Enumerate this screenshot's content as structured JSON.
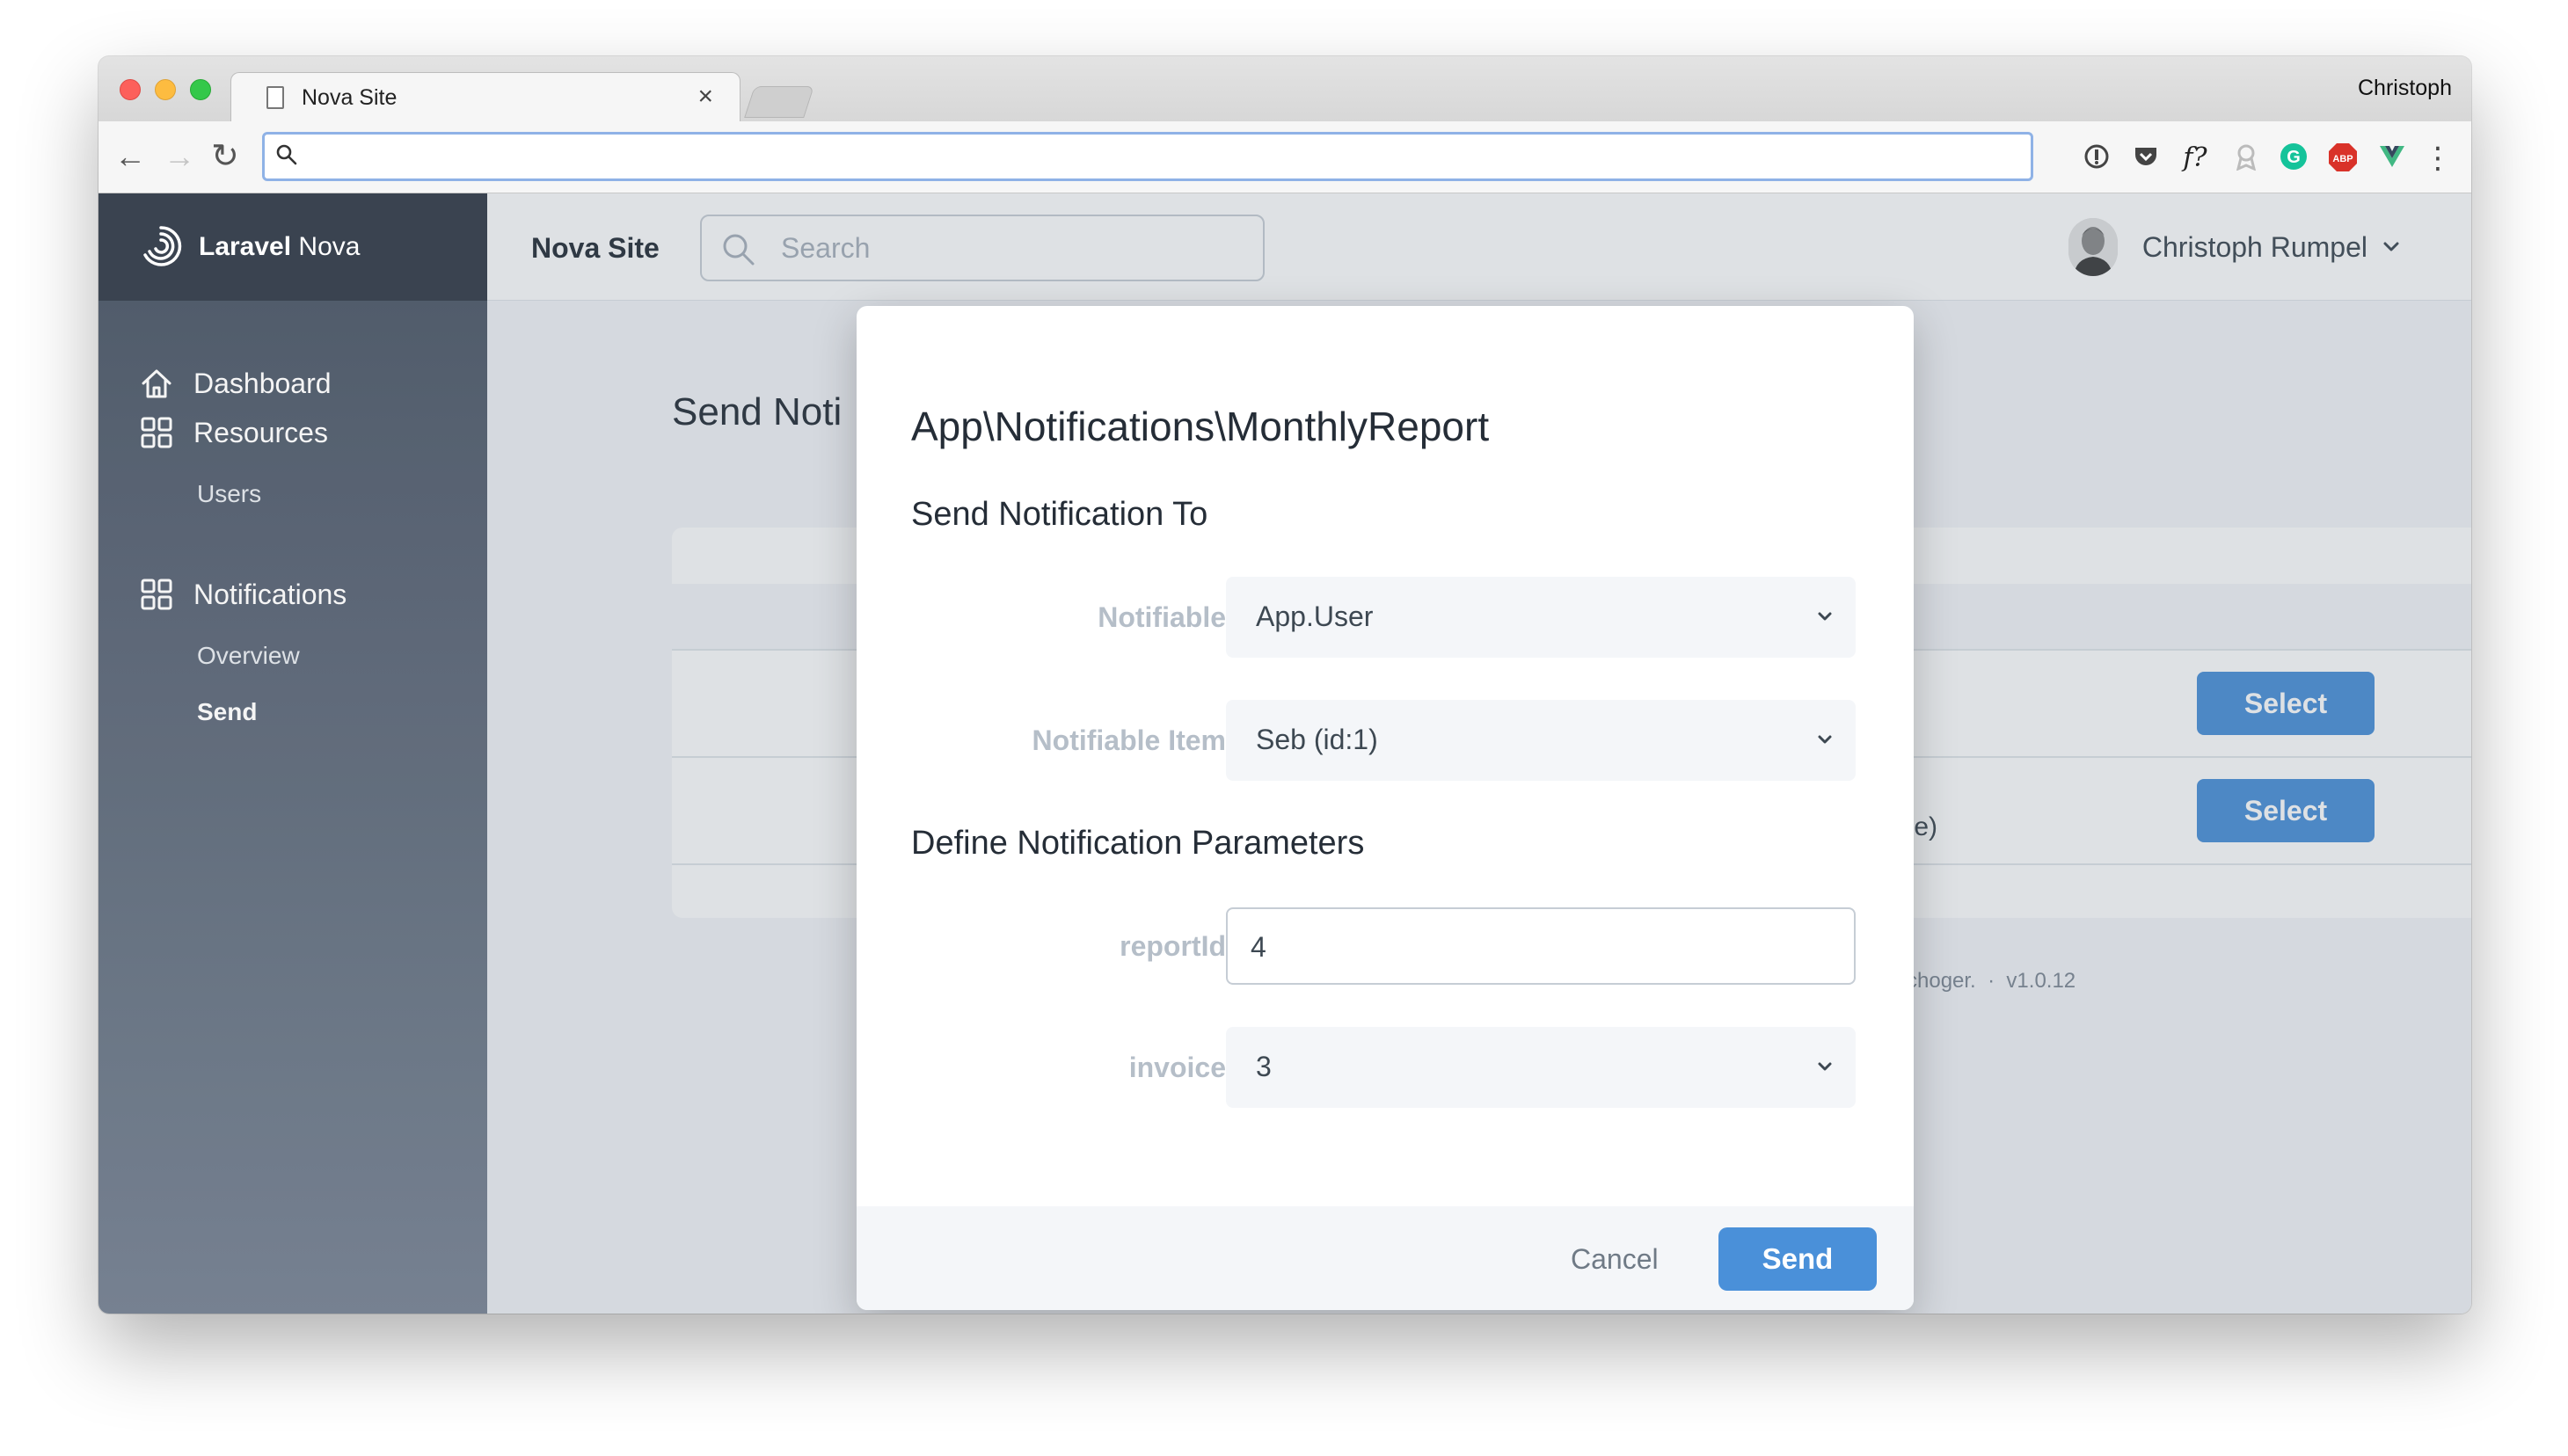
{
  "browser": {
    "tab_title": "Nova Site",
    "tab_close": "×",
    "profile_name": "Christoph",
    "address": ""
  },
  "sidebar": {
    "brand_bold": "Laravel",
    "brand_light": "Nova",
    "items": [
      {
        "label": "Dashboard",
        "icon": "home-icon"
      },
      {
        "label": "Resources",
        "icon": "grid-icon"
      },
      {
        "label": "Notifications",
        "icon": "grid-icon"
      }
    ],
    "resources_sub": [
      "Users"
    ],
    "notifications_sub": [
      "Overview",
      "Send"
    ],
    "active_sub": "Send"
  },
  "header": {
    "site_name": "Nova Site",
    "search_placeholder": "Search",
    "user_name": "Christoph Rumpel"
  },
  "page": {
    "title": "Send Noti",
    "rows": [
      {
        "partial_text": "",
        "button": "Select"
      },
      {
        "partial_text": ":e)",
        "button": "Select"
      }
    ],
    "footer_partial": "choger.",
    "footer_separator": "·",
    "version": "v1.0.12"
  },
  "modal": {
    "title": "App\\Notifications\\MonthlyReport",
    "section_send_to": "Send Notification To",
    "section_params": "Define Notification Parameters",
    "fields": {
      "notifiable": {
        "label": "Notifiable",
        "value": "App.User"
      },
      "notifiable_item": {
        "label": "Notifiable Item",
        "value": "Seb (id:1)"
      },
      "report_id": {
        "label": "reportId",
        "value": "4"
      },
      "invoice": {
        "label": "invoice",
        "value": "3"
      }
    },
    "cancel_label": "Cancel",
    "send_label": "Send"
  },
  "colors": {
    "primary": "#4a90d9",
    "sidebar_top": "#515c6c",
    "sidebar_bottom": "#7b8797",
    "brand_bar": "#3a4350"
  }
}
